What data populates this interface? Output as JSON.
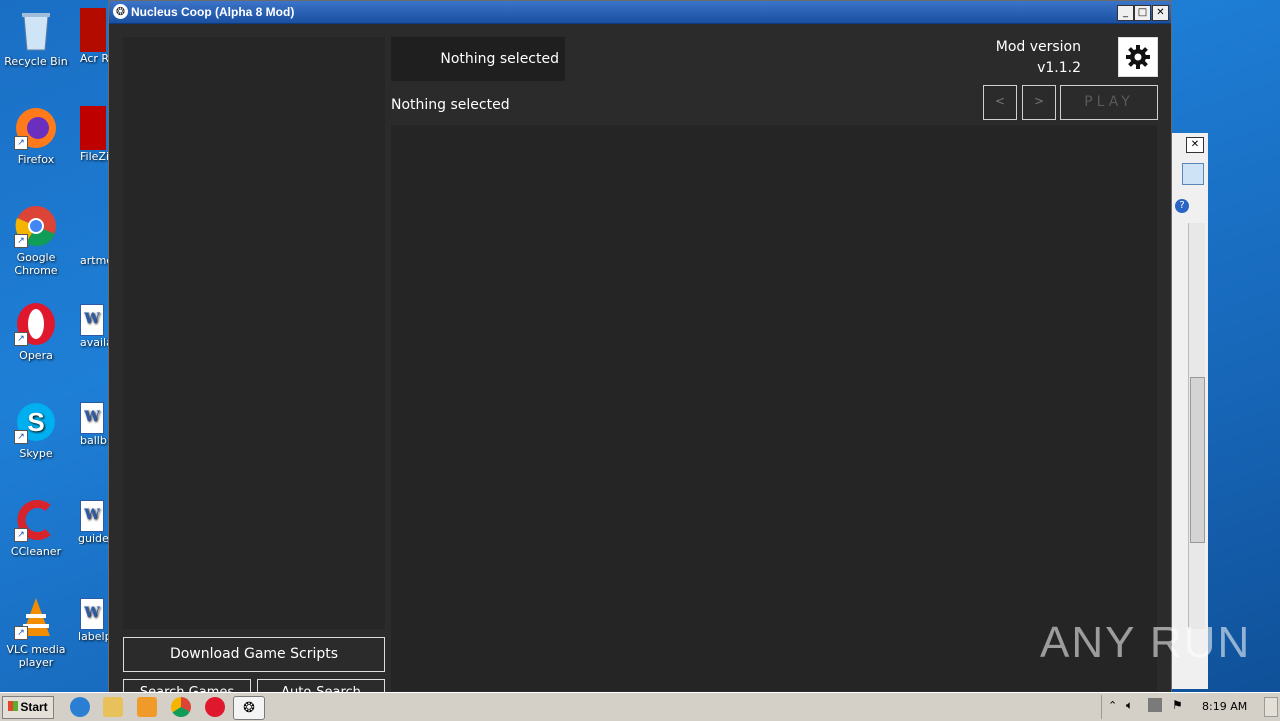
{
  "window": {
    "title": "Nucleus Coop (Alpha 8 Mod)",
    "buttons": [
      "_",
      "□",
      "✕"
    ]
  },
  "header": {
    "selected_box": "Nothing selected",
    "selected_label": "Nothing selected",
    "mod_version_label": "Mod version",
    "mod_version_value": "v1.1.2",
    "prev": "<",
    "next": ">",
    "play": "PLAY"
  },
  "left": {
    "download_button": "Download Game Scripts",
    "search_games": "Search Games",
    "auto_search": "Auto-Search"
  },
  "desktop": {
    "icons": [
      "Recycle Bin",
      "Firefox",
      "Google Chrome",
      "Opera",
      "Skype",
      "CCleaner",
      "VLC media player"
    ],
    "col2": [
      "Acr Read",
      "FileZil",
      "artme",
      "availa",
      "ballb",
      "guides",
      "labelp"
    ]
  },
  "taskbar": {
    "start": "Start",
    "clock": "8:19 AM"
  },
  "watermark": "ANY RUN"
}
